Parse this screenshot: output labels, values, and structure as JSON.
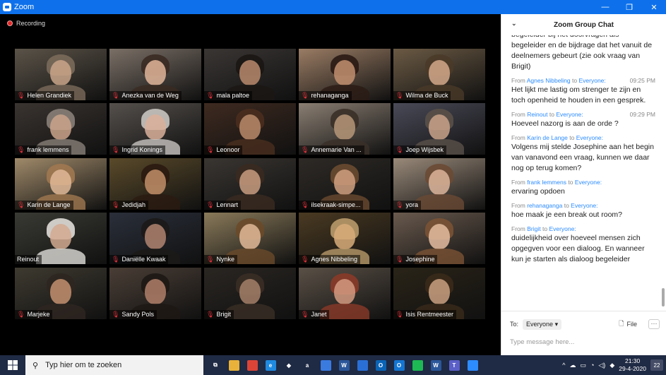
{
  "window": {
    "title": "Zoom",
    "minimize": "—",
    "maximize": "❐",
    "close": "✕"
  },
  "recording": {
    "label": "Recording"
  },
  "participants": [
    {
      "name": "Helen Grandiek",
      "bg": "#5b5348",
      "face": "#c9a48a",
      "hair": "#7a6a5a"
    },
    {
      "name": "Anezka van de Weg",
      "bg": "#7a6f66",
      "face": "#e2b59a",
      "hair": "#3a2a22"
    },
    {
      "name": "mala paltoe",
      "bg": "#3a3634",
      "face": "#b98a6c",
      "hair": "#1a1614"
    },
    {
      "name": "rehanaganga",
      "bg": "#9a7c64",
      "face": "#c28f70",
      "hair": "#2a1a14"
    },
    {
      "name": "Wilma de Buck",
      "bg": "#6b5a44",
      "face": "#d4a88a",
      "hair": "#4a3a28"
    },
    {
      "name": "frank lemmens",
      "bg": "#3a3430",
      "face": "#caa38b",
      "hair": "#888078"
    },
    {
      "name": "Ingrid Konings",
      "bg": "#55504c",
      "face": "#d9b09a",
      "hair": "#c8c4c0"
    },
    {
      "name": "Leonoor",
      "bg": "#3e2a20",
      "face": "#b88a6a",
      "hair": "#4a2e1e"
    },
    {
      "name": "Annemarie Van ...",
      "bg": "#8a7e72",
      "face": "#b69678",
      "hair": "#3a3028"
    },
    {
      "name": "Joep Wijsbek",
      "bg": "#4a4a58",
      "face": "#c9a288",
      "hair": "#5a5048"
    },
    {
      "name": "Karin de Lange",
      "bg": "#a08a6a",
      "face": "#e0b898",
      "hair": "#a07850"
    },
    {
      "name": "Jedidjah",
      "bg": "#5a4a2a",
      "face": "#c28e68",
      "hair": "#2a1a10"
    },
    {
      "name": "Lennart",
      "bg": "#3a3632",
      "face": "#c89c80",
      "hair": "#3a2a20"
    },
    {
      "name": "ilsekraak-simpe...",
      "bg": "#2e2a26",
      "face": "#d0a080",
      "hair": "#6a4a30"
    },
    {
      "name": "yora",
      "bg": "#9a8a7a",
      "face": "#dcb49a",
      "hair": "#6a4a34"
    },
    {
      "name": "Reinout",
      "bg": "#3a3a34",
      "face": "#d4aa90",
      "hair": "#e0ddd8"
    },
    {
      "name": "Daniëlle Kwaak",
      "bg": "#2a2f3a",
      "face": "#b08470",
      "hair": "#1c1a18"
    },
    {
      "name": "Nynke",
      "bg": "#8a7a5a",
      "face": "#e0b898",
      "hair": "#6a4a2a"
    },
    {
      "name": "Agnes Nibbeling",
      "bg": "#4a3a22",
      "face": "#d8ac7a",
      "hair": "#b89a6a"
    },
    {
      "name": "Josephine",
      "bg": "#6a5a4e",
      "face": "#e4bca0",
      "hair": "#7a5234"
    },
    {
      "name": "Marjeke",
      "bg": "#3e3a30",
      "face": "#c49070",
      "hair": "#2e2620"
    },
    {
      "name": "Sandy Pols",
      "bg": "#4a3e36",
      "face": "#b0806a",
      "hair": "#1e1814"
    },
    {
      "name": "Brigit",
      "bg": "#2a2622",
      "face": "#a48068",
      "hair": "#3a2e26"
    },
    {
      "name": "Janet",
      "bg": "#5a5046",
      "face": "#d49a80",
      "hair": "#8a3a28"
    },
    {
      "name": "Isis Rentmeester",
      "bg": "#2a2418",
      "face": "#caa080",
      "hair": "#3a2a1a"
    }
  ],
  "chat": {
    "title": "Zoom Group Chat",
    "partial_top": "begeleider bij het doorvragen als begeleider en de bijdrage dat het vanuit de deelnemers gebeurt (zie ook vraag van Brigit)",
    "messages": [
      {
        "from_label": "From",
        "sender": "Agnes Nibbeling",
        "to_label": "to",
        "recipient": "Everyone:",
        "time": "09:25 PM",
        "text": "Het lijkt me lastig om strenger te zijn en toch openheid te houden in een gesprek."
      },
      {
        "from_label": "From",
        "sender": "Reinout",
        "to_label": "to",
        "recipient": "Everyone:",
        "time": "09:29 PM",
        "text": "Hoeveel nazorg is aan de orde ?"
      },
      {
        "from_label": "From",
        "sender": "Karin de Lange",
        "to_label": "to",
        "recipient": "Everyone:",
        "time": "",
        "text": "Volgens mij stelde Josephine aan het begin van vanavond een vraag, kunnen we daar nog op terug komen?"
      },
      {
        "from_label": "From",
        "sender": "frank lemmens",
        "to_label": "to",
        "recipient": "Everyone:",
        "time": "",
        "text": "ervaring opdoen"
      },
      {
        "from_label": "From",
        "sender": "rehanaganga",
        "to_label": "to",
        "recipient": "Everyone:",
        "time": "",
        "text": "hoe maak je een break out room?"
      },
      {
        "from_label": "From",
        "sender": "Brigit",
        "to_label": "to",
        "recipient": "Everyone:",
        "time": "",
        "text": "duidelijkheid over hoeveel mensen zich opgegven voor een dialoog. En wanneer kun je starten als dialoog begeleider"
      }
    ],
    "to_label": "To:",
    "to_value": "Everyone",
    "file_label": "File",
    "more_label": "···",
    "input_placeholder": "Type message here..."
  },
  "taskbar": {
    "search_placeholder": "Typ hier om te zoeken",
    "apps": [
      {
        "name": "task-view",
        "glyph": "⧉",
        "color": "transparent"
      },
      {
        "name": "file-explorer",
        "glyph": "",
        "color": "#e8b23a"
      },
      {
        "name": "chrome",
        "glyph": "",
        "color": "#db4437"
      },
      {
        "name": "edge",
        "glyph": "e",
        "color": "#1f8ae0"
      },
      {
        "name": "dropbox",
        "glyph": "◆",
        "color": "transparent"
      },
      {
        "name": "amazon",
        "glyph": "a",
        "color": "transparent"
      },
      {
        "name": "store",
        "glyph": "",
        "color": "#3a7be0"
      },
      {
        "name": "word",
        "glyph": "W",
        "color": "#2b579a"
      },
      {
        "name": "calendar",
        "glyph": "",
        "color": "#2a6fd6"
      },
      {
        "name": "outlook-1",
        "glyph": "O",
        "color": "#0a64b6"
      },
      {
        "name": "outlook-2",
        "glyph": "O",
        "color": "#1476d2"
      },
      {
        "name": "spotify",
        "glyph": "",
        "color": "#1db954"
      },
      {
        "name": "word-2",
        "glyph": "W",
        "color": "#2b579a"
      },
      {
        "name": "teams",
        "glyph": "T",
        "color": "#5b5fc7"
      },
      {
        "name": "zoom",
        "glyph": "",
        "color": "#2d8cff"
      }
    ],
    "time": "21:30",
    "date": "29-4-2020",
    "notifications": "22"
  }
}
